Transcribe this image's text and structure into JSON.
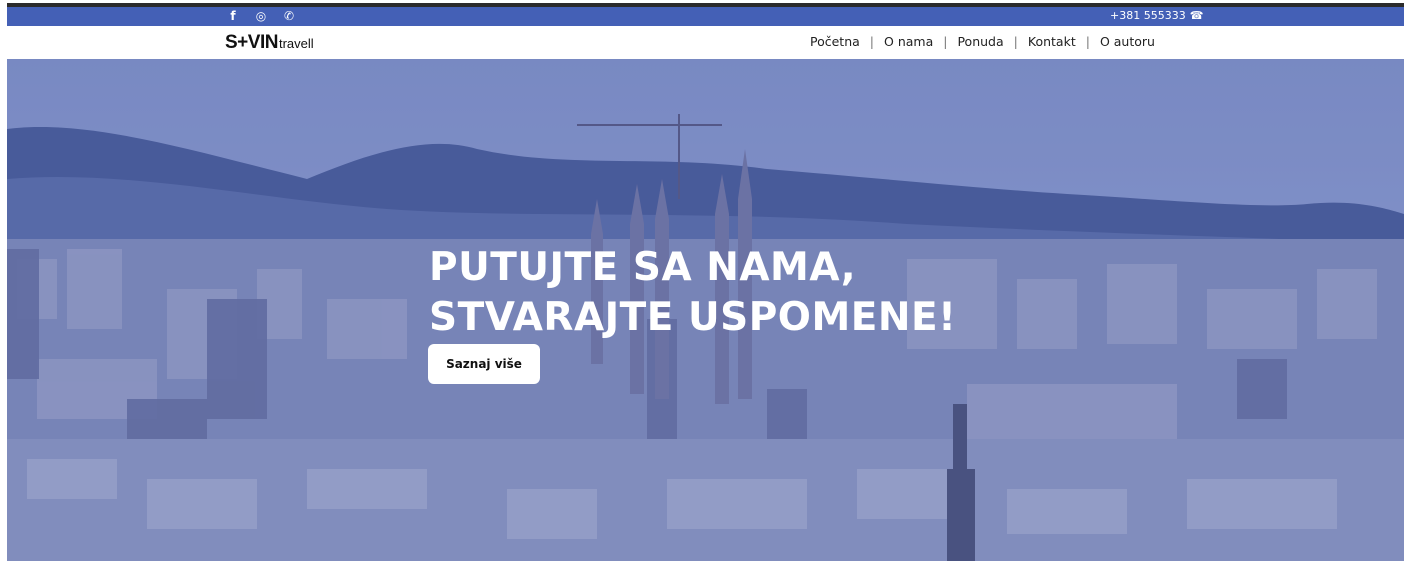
{
  "topbar": {
    "social": [
      {
        "icon": "facebook-icon",
        "glyph": "f"
      },
      {
        "icon": "instagram-icon",
        "glyph": "◎"
      },
      {
        "icon": "whatsapp-icon",
        "glyph": "✆"
      }
    ],
    "phone": "+381 555333",
    "phone_icon": "☎",
    "bar_color": "#4460b6"
  },
  "logo": {
    "main": "S+VIN",
    "sub": "travell"
  },
  "nav": {
    "items": [
      "Početna",
      "O nama",
      "Ponuda",
      "Kontakt",
      "O autoru"
    ],
    "separator": "|"
  },
  "hero": {
    "line1": "PUTUJTE SA NAMA,",
    "line2": "STVARAJTE USPOMENE!",
    "cta_label": "Saznaj više"
  }
}
